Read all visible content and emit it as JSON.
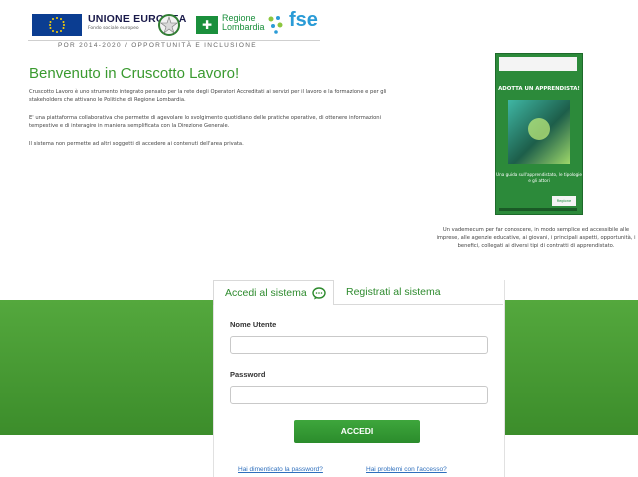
{
  "header": {
    "eu_title": "UNIONE EUROPEA",
    "eu_subtitle": "Fondo sociale europeo",
    "regione_line1": "Regione",
    "regione_line2": "Lombardia",
    "fse_label": "fse",
    "tagline": "POR 2014-2020 / OPPORTUNITÀ E INCLUSIONE"
  },
  "welcome": {
    "title": "Benvenuto in Cruscotto Lavoro!",
    "paragraph1": "Cruscotto Lavoro è uno strumento integrato pensato per la rete degli Operatori Accreditati ai servizi per il lavoro e la formazione e per gli stakeholders che attivano le Politiche di Regione Lombardia.",
    "paragraph2": "E' una piattaforma collaborativa che permette di agevolare lo svolgimento quotidiano delle pratiche operative, di ottenere informazioni tempestive e di interagire in maniera semplificata con la Direzione Generale.",
    "paragraph3": "Il sistema non permette ad altri soggetti di accedere ai contenuti dell'area privata."
  },
  "brochure": {
    "title": "ADOTTA UN APPRENDISTA!",
    "subtitle": "Una guida sull'apprendistato, le tipologie e gli attori",
    "logo": "Regione Lombardia",
    "caption": "Un vademecum per far conoscere, in modo semplice ed accessibile alle imprese, alle agenzie educative, ai giovani, i principali aspetti, opportunità, i benefici, collegati ai diversi tipi di contratti di apprendistato."
  },
  "login": {
    "tab_login": "Accedi al sistema",
    "tab_register": "Registrati al sistema",
    "username_label": "Nome Utente",
    "username_value": "",
    "password_label": "Password",
    "password_value": "",
    "submit_label": "ACCEDI",
    "forgot_password": "Hai dimenticato la password?",
    "access_help": "Hai problemi con l'accesso?"
  },
  "colors": {
    "brand_green": "#3a9a2f",
    "band_green": "#4c9f36",
    "link_blue": "#2e6fbd",
    "fse_blue": "#2a9bd6"
  }
}
